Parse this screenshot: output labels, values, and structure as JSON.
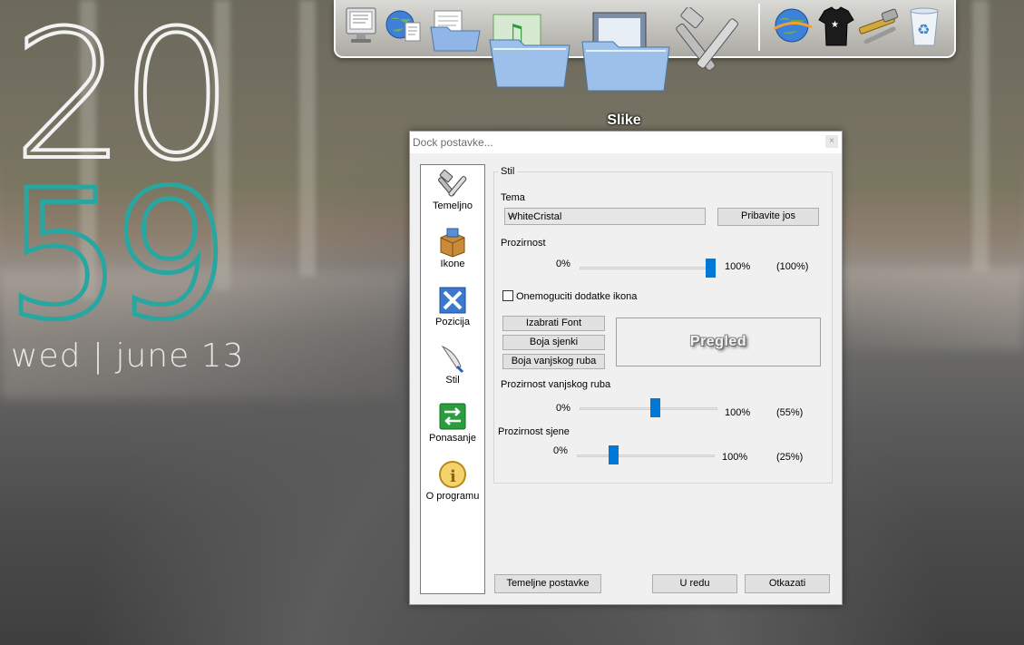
{
  "clock": {
    "hours": "20",
    "minutes": "59",
    "date": "wed | june 13"
  },
  "dock": {
    "hover_label": "Slike"
  },
  "dialog": {
    "title": "Dock postavke...",
    "close_glyph": "×",
    "sidebar": [
      {
        "label": "Temeljno",
        "icon": "tools-icon"
      },
      {
        "label": "Ikone",
        "icon": "box-icon"
      },
      {
        "label": "Pozicija",
        "icon": "arrows-icon"
      },
      {
        "label": "Stil",
        "icon": "quill-icon"
      },
      {
        "label": "Ponasanje",
        "icon": "switch-arrows-icon"
      },
      {
        "label": "O programu",
        "icon": "info-icon"
      }
    ],
    "group_title": "Stil",
    "theme": {
      "label": "Tema",
      "value": "WhiteCristal",
      "more_button": "Pribavite jos"
    },
    "transparency": {
      "label": "Prozirnost",
      "min": "0%",
      "max": "100%",
      "value_text": "(100%)",
      "value": 100
    },
    "disable_icon_addons": {
      "label": "Onemoguciti dodatke ikona",
      "checked": false
    },
    "buttons": {
      "font": "Izabrati Font",
      "shadow_color": "Boja sjenki",
      "border_color": "Boja vanjskog ruba"
    },
    "preview_text": "Pregled",
    "border_transparency": {
      "label": "Prozirnost vanjskog ruba",
      "min": "0%",
      "max": "100%",
      "value_text": "(55%)",
      "value": 55
    },
    "shadow_transparency": {
      "label": "Prozirnost sjene",
      "min": "0%",
      "max": "100%",
      "value_text": "(25%)",
      "value": 25
    },
    "footer": {
      "defaults": "Temeljne postavke",
      "ok": "U redu",
      "cancel": "Otkazati"
    }
  },
  "colors": {
    "accent": "#0078d7",
    "clock_minutes": "#2aa6a0"
  }
}
